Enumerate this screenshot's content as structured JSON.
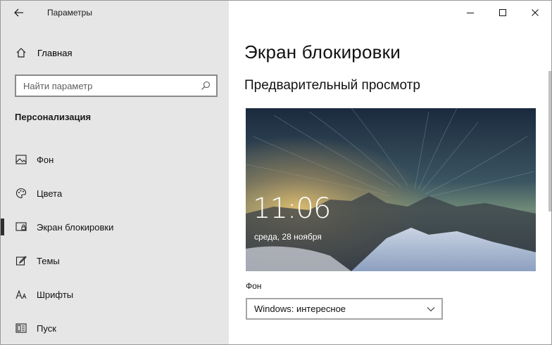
{
  "window": {
    "title": "Параметры"
  },
  "sidebar": {
    "home_label": "Главная",
    "search_placeholder": "Найти параметр",
    "section_title": "Персонализация",
    "items": [
      {
        "label": "Фон",
        "icon": "picture-icon"
      },
      {
        "label": "Цвета",
        "icon": "palette-icon"
      },
      {
        "label": "Экран блокировки",
        "icon": "lock-screen-icon",
        "active": true
      },
      {
        "label": "Темы",
        "icon": "brush-icon"
      },
      {
        "label": "Шрифты",
        "icon": "font-icon"
      },
      {
        "label": "Пуск",
        "icon": "start-icon"
      }
    ]
  },
  "content": {
    "page_title": "Экран блокировки",
    "preview_title": "Предварительный просмотр",
    "preview": {
      "time": "11:06",
      "date": "среда, 28 ноября"
    },
    "background_label": "Фон",
    "background_value": "Windows: интересное"
  },
  "colors": {
    "sidebar_bg": "#e6e6e6",
    "accent_bar": "#2f2f2f"
  }
}
